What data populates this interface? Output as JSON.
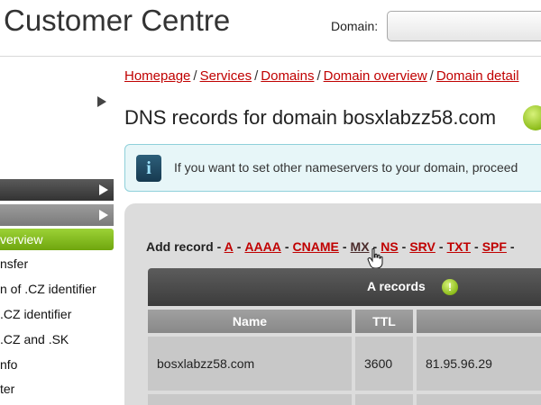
{
  "header": {
    "title": "Customer Centre",
    "domain_label": "Domain:"
  },
  "sidebar": {
    "active_label": "verview",
    "items": [
      "nsfer",
      "n of .CZ identifier",
      ".CZ identifier",
      ".CZ and .SK",
      "nfo",
      "ter"
    ]
  },
  "breadcrumb": [
    "Homepage",
    "Services",
    "Domains",
    "Domain overview",
    "Domain detail"
  ],
  "page": {
    "title": "DNS records for domain bosxlabzz58.com"
  },
  "info": {
    "icon": "i",
    "text": "If you want to set other nameservers to your domain, proceed"
  },
  "add_record": {
    "label": "Add record -",
    "types": [
      "A",
      "AAAA",
      "CNAME",
      "MX",
      "NS",
      "SRV",
      "TXT",
      "SPF"
    ]
  },
  "a_records": {
    "title": "A records",
    "badge": "!",
    "columns": [
      "Name",
      "TTL",
      ""
    ],
    "rows": [
      {
        "name": "bosxlabzz58.com",
        "ttl": "3600",
        "value": "81.95.96.29"
      }
    ]
  },
  "colors": {
    "link": "#c00000",
    "active_green": "#8cbc1a",
    "info_bg": "#e7f6f8"
  }
}
